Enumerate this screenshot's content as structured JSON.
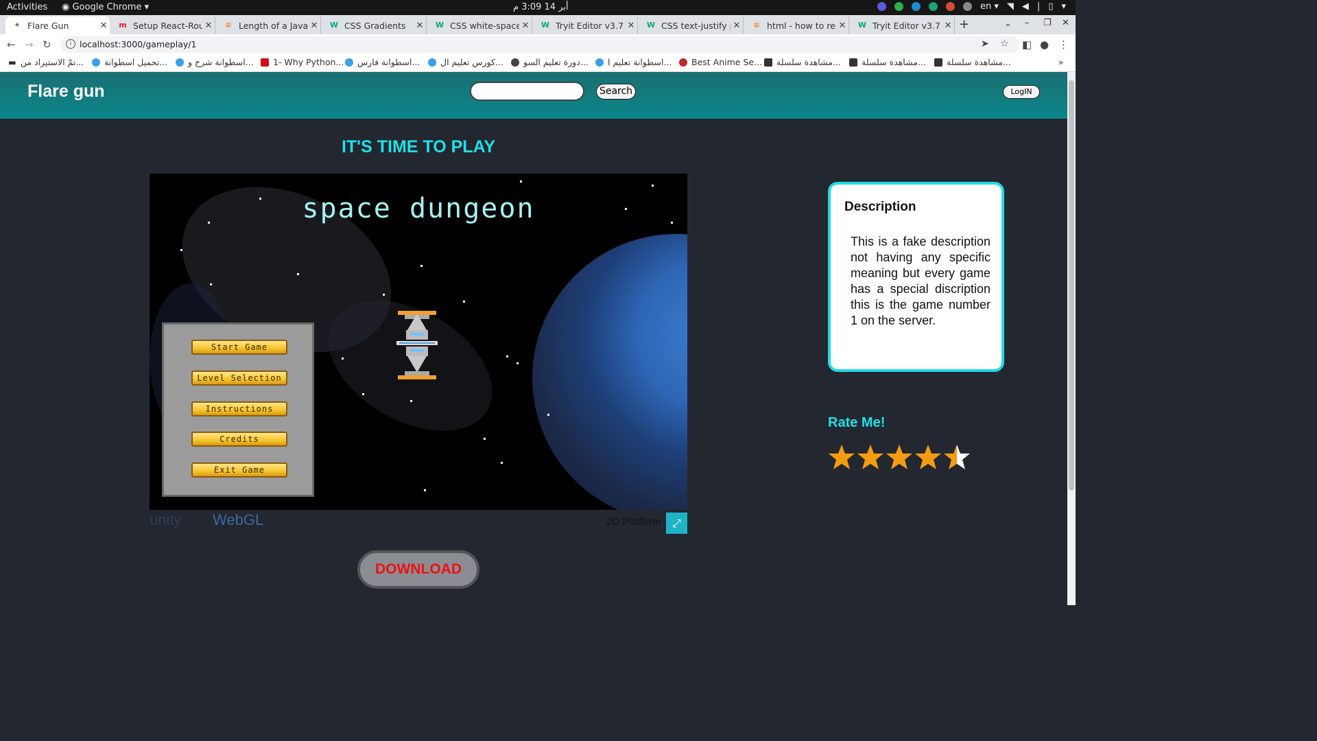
{
  "os": {
    "activities": "Activities",
    "app_menu": "Google Chrome",
    "clock": "أبر 14  3:09 م",
    "lang": "en"
  },
  "tabs": [
    {
      "title": "Flare Gun",
      "active": true,
      "icon": "flare-icon"
    },
    {
      "title": "Setup React-Route",
      "icon": "medium-icon"
    },
    {
      "title": "Length of a JavaS",
      "icon": "stackoverflow-icon"
    },
    {
      "title": "CSS Gradients",
      "icon": "w3schools-icon"
    },
    {
      "title": "CSS white-space p",
      "icon": "w3schools-icon"
    },
    {
      "title": "Tryit Editor v3.7",
      "icon": "w3schools-icon"
    },
    {
      "title": "CSS text-justify pr",
      "icon": "w3schools-icon"
    },
    {
      "title": "html - how to rem",
      "icon": "stackoverflow-icon"
    },
    {
      "title": "Tryit Editor v3.7",
      "icon": "w3schools-icon"
    }
  ],
  "address": {
    "url": "localhost:3000/gameplay/1"
  },
  "bookmarks": [
    "تمّ الاستيراد من...",
    "تحميل اسطوانة...",
    "اسطوانة شرح و...",
    "1- Why Python...",
    "اسطوانة فارس...",
    "كورس تعليم ال...",
    "دورة تعليم السو...",
    "اسطوانة تعليم ا...",
    "Best Anime Se...",
    "مشاهدة سلسلة...",
    "مشاهدة سلسلة...",
    "مشاهدة سلسلة..."
  ],
  "site": {
    "brand": "Flare gun",
    "search_value": "",
    "search_button": "Search",
    "login_button": "LogIN"
  },
  "main": {
    "headline": "IT'S TIME TO PLAY",
    "download": "DOWNLOAD"
  },
  "game": {
    "title": "space dungeon",
    "menu": [
      "Start Game",
      "Level Selection",
      "Instructions",
      "Credits",
      "Exit Game"
    ],
    "engine_brand": "unity",
    "engine_target": "WebGL",
    "platform": "2D Platform"
  },
  "description": {
    "heading": "Description",
    "text": "This is a fake description not having any specific meaning but every game has a special discription this is the game number 1 on the server."
  },
  "rating": {
    "label": "Rate Me!",
    "value": 4.5,
    "max": 5,
    "star_color": "#f39c12"
  }
}
